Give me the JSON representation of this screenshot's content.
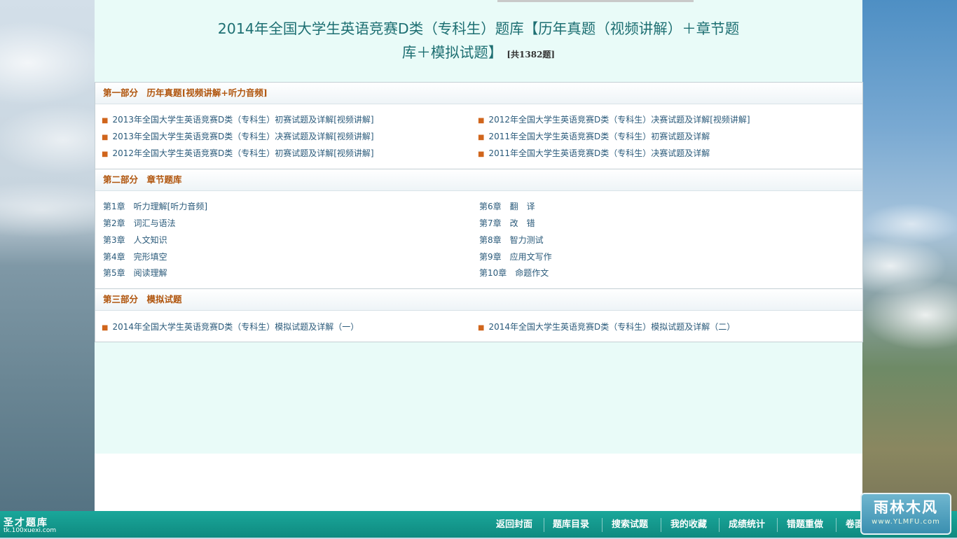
{
  "title": {
    "line1": "2014年全国大学生英语竞赛D类（专科生）题库【历年真题（视频讲解）＋章节题",
    "line2": "库＋模拟试题】",
    "count": "[共1382题]"
  },
  "sections": [
    {
      "heading": "第一部分　历年真题[视频讲解+听力音频]",
      "left": [
        "2013年全国大学生英语竞赛D类（专科生）初赛试题及详解[视频讲解]",
        "2013年全国大学生英语竞赛D类（专科生）决赛试题及详解[视频讲解]",
        "2012年全国大学生英语竞赛D类（专科生）初赛试题及详解[视频讲解]"
      ],
      "right": [
        "2012年全国大学生英语竞赛D类（专科生）决赛试题及详解[视频讲解]",
        "2011年全国大学生英语竞赛D类（专科生）初赛试题及详解",
        "2011年全国大学生英语竞赛D类（专科生）决赛试题及详解"
      ]
    },
    {
      "heading": "第二部分　章节题库",
      "left": [
        "第1章　听力理解[听力音频]",
        "第2章　词汇与语法",
        "第3章　人文知识",
        "第4章　完形填空",
        "第5章　阅读理解"
      ],
      "right": [
        "第6章　翻　译",
        "第7章　改　错",
        "第8章　智力测试",
        "第9章　应用文写作",
        "第10章　命题作文"
      ]
    },
    {
      "heading": "第三部分　模拟试题",
      "left": [
        "2014年全国大学生英语竞赛D类（专科生）模拟试题及详解（一）"
      ],
      "right": [
        "2014年全国大学生英语竞赛D类（专科生）模拟试题及详解（二）"
      ]
    }
  ],
  "footer": {
    "brand": "圣才题库",
    "url": "tk.100xuexi.com",
    "nav": [
      "返回封面",
      "题库目录",
      "搜索试题",
      "我的收藏",
      "成绩统计",
      "错题重做",
      "卷面"
    ]
  },
  "watermark": {
    "name": "雨林木风",
    "url": "www.YLMFU.com"
  },
  "colors": {
    "title": "#1d6f72",
    "section_heading": "#b0550d",
    "link": "#2a5a7a",
    "bullet": "#d0651c",
    "footer_bg": "#13998d",
    "panel_bg": "#e9fbf8"
  }
}
